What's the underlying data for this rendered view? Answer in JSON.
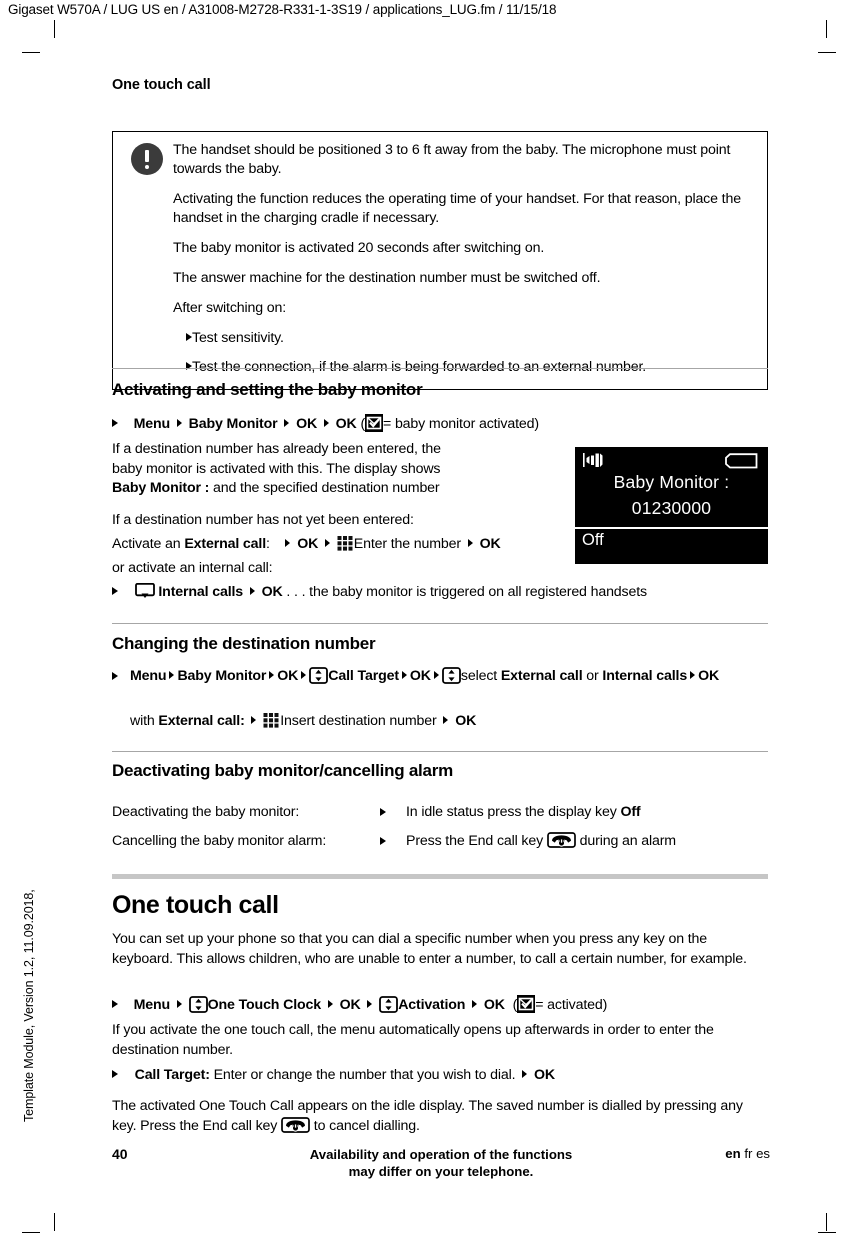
{
  "doc": {
    "header_line": "Gigaset W570A / LUG US en / A31008-M2728-R331-1-3S19 / applications_LUG.fm / 11/15/18",
    "side_note": "Template Module, Version 1.2, 11.09.2018,",
    "running_head": "One touch call"
  },
  "note_box": {
    "icon": "exclamation-icon",
    "paragraphs": [
      "The handset should be positioned 3 to 6 ft away from the baby. The microphone must point towards the baby.",
      "Activating the function reduces the operating time of your handset. For that reason, place the handset in the charging cradle if necessary.",
      "The baby monitor is activated 20 seconds after switching on.",
      "The answer machine for the destination number must be switched off.",
      "After switching on:"
    ],
    "bullets": [
      "Test sensitivity.",
      "Test the connection, if the alarm is being forwarded to an external number."
    ]
  },
  "sections": {
    "activating": {
      "heading": "Activating and setting the baby monitor",
      "step": {
        "menu": "Menu",
        "baby_monitor": "Baby Monitor",
        "ok1": "OK",
        "ok2": "OK",
        "paren_open": "(",
        "checkbox_note": "= baby monitor activated)"
      },
      "para1_a": "If a destination number has already been entered, the baby monitor is activated with this. The display shows ",
      "para1_b": "Baby Monitor :",
      "para1_c": " and the specified destination number",
      "para2": "If a destination number has not yet been entered:",
      "ext_line": {
        "lead": "Activate an ",
        "bold": "External call",
        "colon": ":",
        "ok1": "OK",
        "enter": "Enter the number",
        "ok2": "OK"
      },
      "para3": "or activate an internal call:",
      "int_line": {
        "label": "Internal calls",
        "ok": "OK",
        "tail": ". . . the baby monitor is triggered on all registered handsets"
      }
    },
    "changing": {
      "heading": "Changing the destination number",
      "step1": {
        "menu": "Menu",
        "baby_monitor": "Baby Monitor",
        "ok1": "OK",
        "call_target": "Call Target",
        "ok2": "OK",
        "select": "select ",
        "external": "External  call",
        "or": " or ",
        "internal": "Internal calls",
        "ok3": "OK"
      },
      "step2": {
        "lead": "with ",
        "bold": "External call:",
        "insert": "Insert destination number",
        "ok": "OK"
      }
    },
    "deactivating": {
      "heading": "Deactivating baby monitor/cancelling alarm",
      "rows": [
        {
          "label": "Deactivating the baby monitor:",
          "text_a": "In idle status press the display key ",
          "text_b": "Off",
          "text_c": ""
        },
        {
          "label": "Cancelling the baby monitor  alarm:",
          "text_a": "Press the End call key ",
          "text_b": "",
          "text_c": " during an alarm"
        }
      ]
    },
    "one_touch": {
      "heading": "One touch call",
      "intro": "You can set up your phone so that you can dial a specific number when you press any key on the keyboard. This allows children, who are unable to enter a number, to call a certain number, for example.",
      "step1": {
        "menu": "Menu",
        "one_touch_clock": "One Touch Clock",
        "ok1": "OK",
        "activation": "Activation",
        "ok2": "OK",
        "paren_open": "(",
        "checkbox_note": "= activated)"
      },
      "para1": "If you activate the one touch call, the menu automatically opens up afterwards in order to enter the destination number.",
      "step2": {
        "bold": "Call Target:",
        "text": " Enter or change the number that you wish to dial.",
        "ok": "OK"
      },
      "para2_a": "The activated One Touch Call appears on the idle display. The saved number is dialled by pressing any key. Press the End call key ",
      "para2_b": " to cancel dialling."
    }
  },
  "handset": {
    "signal_icon": "signal-strength-icon",
    "battery_icon": "battery-icon",
    "line1": "Baby Monitor :",
    "line2": "01230000",
    "softkey": "Off"
  },
  "footer": {
    "page_number": "40",
    "center_line1": "Availability and operation of the functions",
    "center_line2": "may differ on your telephone.",
    "lang_current": "en",
    "lang_others": " fr es"
  },
  "colors": {
    "rule_thin": "#a6a6a6",
    "rule_thick": "#c6c6c6",
    "note_icon_bg": "#3b3b3b",
    "display_bg": "#000000",
    "display_fg": "#ffffff"
  }
}
